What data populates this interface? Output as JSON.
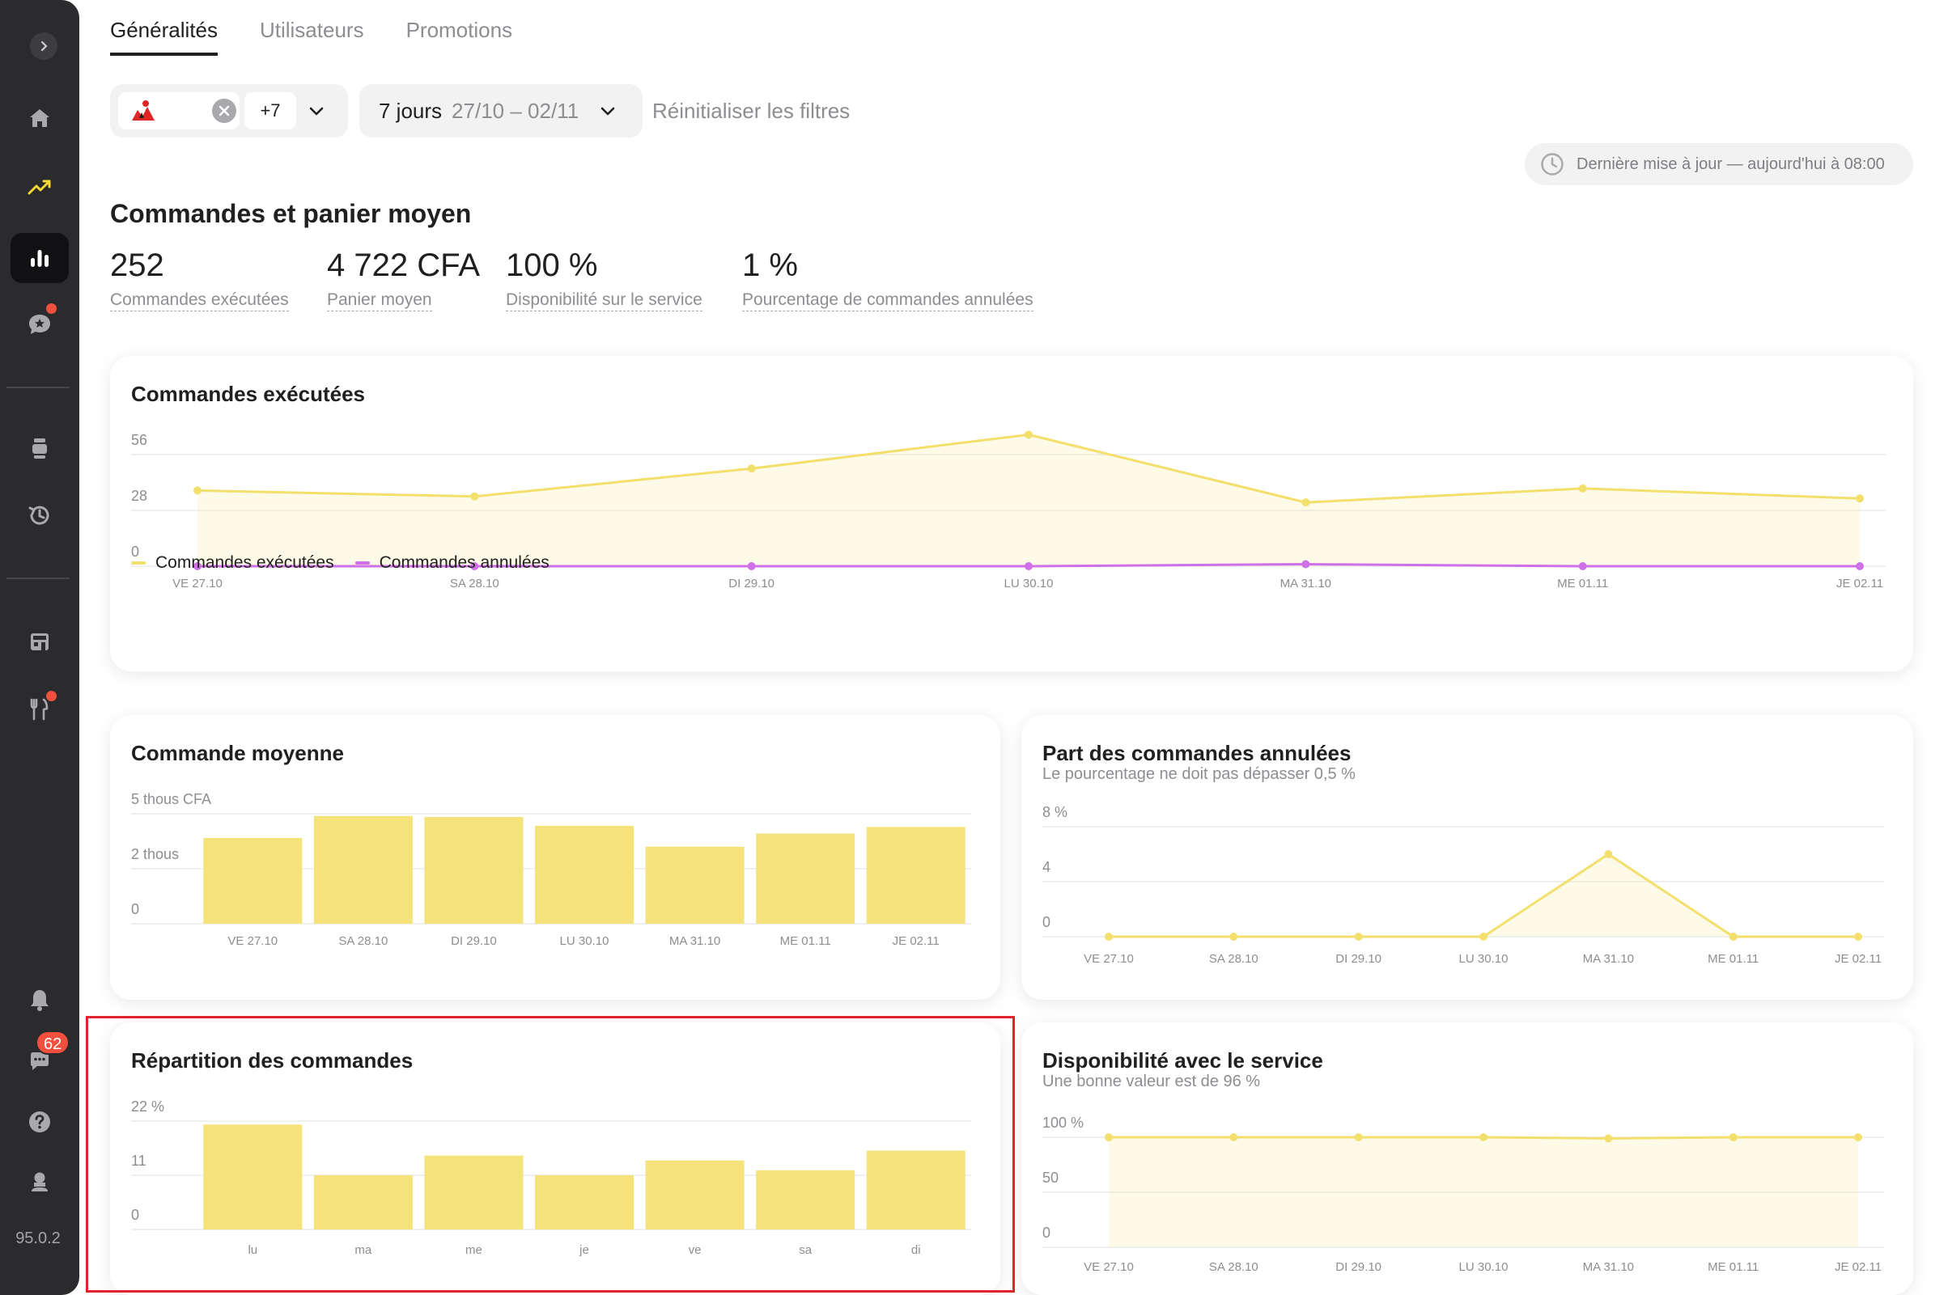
{
  "sidebar": {
    "version": "95.0.2",
    "messages_count": "62",
    "icons": [
      "expand-icon",
      "home-icon",
      "trend-icon",
      "analytics-icon",
      "reviews-icon",
      "device-icon",
      "history-icon",
      "store-icon",
      "menu-icon",
      "notifications-icon",
      "chat-icon",
      "help-icon",
      "profile-icon"
    ]
  },
  "tabs": [
    "Généralités",
    "Utilisateurs",
    "Promotions"
  ],
  "filters": {
    "restaurants_more": "+7",
    "period_label": "7 jours",
    "period_range": "27/10 – 02/11",
    "reset_label": "Réinitialiser les filtres"
  },
  "last_update": "Dernière mise à jour — aujourd'hui à 08:00",
  "summary": {
    "title": "Commandes et panier moyen",
    "kpis": [
      {
        "value": "252",
        "label": "Commandes exécutées"
      },
      {
        "value": "4 722 CFA",
        "label": "Panier moyen"
      },
      {
        "value": "100 %",
        "label": "Disponibilité sur le service"
      },
      {
        "value": "1 %",
        "label": "Pourcentage de commandes annulées"
      }
    ]
  },
  "colors": {
    "yellow": "#f5e27a",
    "yellow_line": "#f3df6c",
    "purple": "#d070e8",
    "highlight": "#e3222e"
  },
  "chart_data": [
    {
      "id": "orders",
      "type": "line",
      "title": "Commandes exécutées",
      "categories": [
        "VE 27.10",
        "SA 28.10",
        "DI 29.10",
        "LU 30.10",
        "MA 31.10",
        "ME 01.11",
        "JE 02.11"
      ],
      "series": [
        {
          "name": "Commandes exécutées",
          "values": [
            38,
            35,
            49,
            66,
            32,
            39,
            34
          ]
        },
        {
          "name": "Commandes annulées",
          "values": [
            0,
            0,
            0,
            0,
            1,
            0,
            0
          ]
        }
      ],
      "yticks": [
        "56",
        "28",
        "0"
      ],
      "ylim": [
        0,
        56
      ],
      "grid": true,
      "legend": "bottom-left"
    },
    {
      "id": "avg",
      "type": "bar",
      "title": "Commande moyenne",
      "categories": [
        "VE 27.10",
        "SA 28.10",
        "DI 29.10",
        "LU 30.10",
        "MA 31.10",
        "ME 01.11",
        "JE 02.11"
      ],
      "values": [
        3900,
        4900,
        4850,
        4450,
        3500,
        4100,
        4400
      ],
      "yticks": [
        "5 thous CFA",
        "2 thous",
        "0"
      ],
      "ylim": [
        0,
        5000
      ],
      "grid": true
    },
    {
      "id": "cancel",
      "type": "area",
      "title": "Part des commandes annulées",
      "subtitle": "Le pourcentage ne doit pas dépasser 0,5 %",
      "categories": [
        "VE 27.10",
        "SA 28.10",
        "DI 29.10",
        "LU 30.10",
        "MA 31.10",
        "ME 01.11",
        "JE 02.11"
      ],
      "values": [
        0,
        0,
        0,
        0,
        6,
        0,
        0
      ],
      "yticks": [
        "8 %",
        "4",
        "0"
      ],
      "ylim": [
        0,
        8
      ],
      "grid": true
    },
    {
      "id": "dist",
      "type": "bar",
      "title": "Répartition des commandes",
      "categories": [
        "lu",
        "ma",
        "me",
        "je",
        "ve",
        "sa",
        "di"
      ],
      "values": [
        21.3,
        11,
        15,
        11,
        14,
        12,
        16
      ],
      "yticks": [
        "22 %",
        "11",
        "0"
      ],
      "ylim": [
        0,
        22
      ],
      "grid": true
    },
    {
      "id": "avail",
      "type": "area",
      "title": "Disponibilité avec le service",
      "subtitle": "Une bonne valeur est de 96 %",
      "categories": [
        "VE 27.10",
        "SA 28.10",
        "DI 29.10",
        "LU 30.10",
        "MA 31.10",
        "ME 01.11",
        "JE 02.11"
      ],
      "values": [
        100,
        100,
        100,
        100,
        99,
        100,
        100
      ],
      "yticks": [
        "100 %",
        "50",
        "0"
      ],
      "ylim": [
        0,
        100
      ],
      "grid": true
    }
  ]
}
